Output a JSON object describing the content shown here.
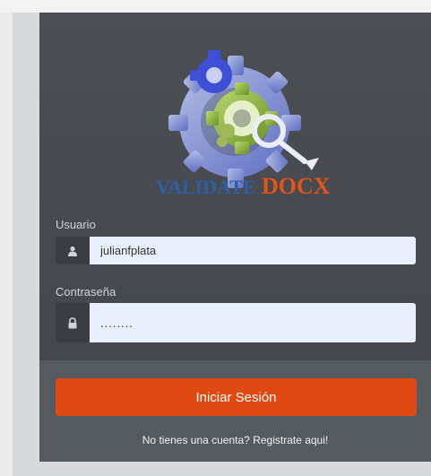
{
  "brand": {
    "logo_text_validate": "VALIDATE",
    "logo_text_docx": "DOCX"
  },
  "form": {
    "username_label": "Usuario",
    "username_value": "julianfplata",
    "password_label": "Contraseña",
    "password_value": "........",
    "login_button": "Iniciar Sesión",
    "register_link": "No tienes una cuenta? Registrate aqui!"
  },
  "icons": {
    "username": "user-icon",
    "password": "lock-icon"
  },
  "colors": {
    "panel": "#474b4f",
    "panel_footer": "#555a5f",
    "input_bg": "#e9f0fd",
    "login_button": "#df4a12",
    "logo_validate": "#2d5fa8",
    "logo_docx": "#e25417"
  }
}
